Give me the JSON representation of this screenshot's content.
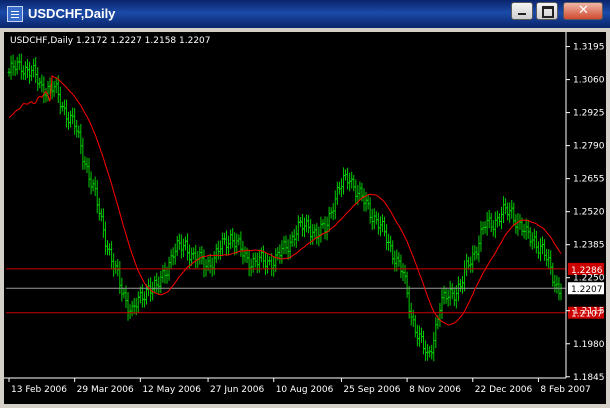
{
  "window": {
    "title": "USDCHF,Daily",
    "buttons": {
      "minimize": "minimize-icon",
      "maximize": "maximize-icon",
      "close": "close-icon"
    }
  },
  "chart": {
    "header": "USDCHF,Daily  1.2172 1.2227 1.2158 1.2207"
  },
  "chart_data": {
    "type": "bar",
    "title": "USDCHF,Daily",
    "ylim": [
      1.184,
      1.323
    ],
    "y_ticks": [
      1.3195,
      1.306,
      1.2925,
      1.279,
      1.2655,
      1.252,
      1.2385,
      1.225,
      1.2115,
      1.198,
      1.1845
    ],
    "y_tick_labels": [
      "1.3195",
      "1.3060",
      "1.2925",
      "1.2790",
      "1.2655",
      "1.2520",
      "1.2385",
      "1.2250",
      "1.2115",
      "1.1980",
      "1.1845"
    ],
    "x_tick_labels": [
      "13 Feb 2006",
      "29 Mar 2006",
      "12 May 2006",
      "27 Jun 2006",
      "10 Aug 2006",
      "25 Sep 2006",
      "8 Nov 2006",
      "22 Dec 2006",
      "8 Feb 2007"
    ],
    "x_tick_positions": [
      0,
      32,
      64,
      97,
      129,
      162,
      194,
      226,
      258
    ],
    "last_ohlc": {
      "open": 1.2172,
      "high": 1.2227,
      "low": 1.2158,
      "close": 1.2207
    },
    "current_price_label": "1.2207",
    "horizontal_lines": [
      {
        "value": 1.2286,
        "label": "1.2286",
        "color": "#cc0000"
      },
      {
        "value": 1.2107,
        "label": "1.2107",
        "color": "#cc0000"
      }
    ],
    "bar_color": "#00cc00",
    "ma_color": "#ff0000",
    "close_anchors": [
      [
        0,
        1.309
      ],
      [
        6,
        1.312
      ],
      [
        11,
        1.309
      ],
      [
        16,
        1.303
      ],
      [
        22,
        1.302
      ],
      [
        27,
        1.294
      ],
      [
        32,
        1.287
      ],
      [
        37,
        1.273
      ],
      [
        42,
        1.258
      ],
      [
        46,
        1.245
      ],
      [
        50,
        1.232
      ],
      [
        55,
        1.22
      ],
      [
        60,
        1.211
      ],
      [
        64,
        1.216
      ],
      [
        68,
        1.222
      ],
      [
        72,
        1.22
      ],
      [
        76,
        1.228
      ],
      [
        80,
        1.235
      ],
      [
        86,
        1.239
      ],
      [
        90,
        1.233
      ],
      [
        95,
        1.231
      ],
      [
        100,
        1.232
      ],
      [
        105,
        1.24
      ],
      [
        108,
        1.242
      ],
      [
        112,
        1.237
      ],
      [
        116,
        1.233
      ],
      [
        120,
        1.231
      ],
      [
        125,
        1.232
      ],
      [
        130,
        1.232
      ],
      [
        135,
        1.238
      ],
      [
        140,
        1.244
      ],
      [
        146,
        1.247
      ],
      [
        150,
        1.242
      ],
      [
        154,
        1.245
      ],
      [
        158,
        1.256
      ],
      [
        163,
        1.264
      ],
      [
        166,
        1.267
      ],
      [
        170,
        1.259
      ],
      [
        175,
        1.254
      ],
      [
        180,
        1.247
      ],
      [
        184,
        1.241
      ],
      [
        188,
        1.234
      ],
      [
        192,
        1.226
      ],
      [
        196,
        1.21
      ],
      [
        200,
        1.2
      ],
      [
        204,
        1.192
      ],
      [
        207,
        1.201
      ],
      [
        210,
        1.213
      ],
      [
        215,
        1.219
      ],
      [
        220,
        1.221
      ],
      [
        224,
        1.231
      ],
      [
        228,
        1.238
      ],
      [
        232,
        1.246
      ],
      [
        236,
        1.248
      ],
      [
        240,
        1.251
      ],
      [
        245,
        1.252
      ],
      [
        248,
        1.248
      ],
      [
        252,
        1.242
      ],
      [
        256,
        1.241
      ],
      [
        260,
        1.236
      ],
      [
        264,
        1.228
      ],
      [
        268,
        1.22
      ],
      [
        270,
        1.22
      ]
    ]
  }
}
